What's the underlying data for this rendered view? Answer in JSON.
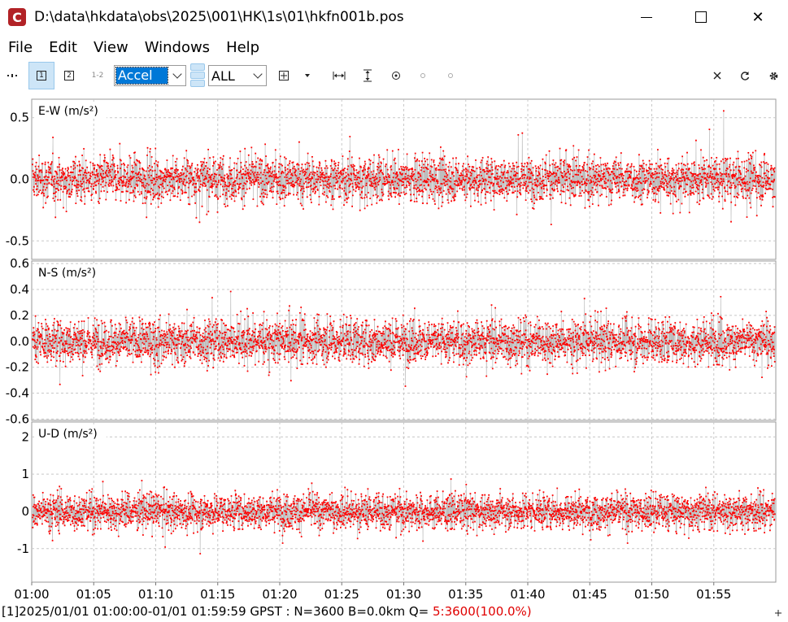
{
  "window": {
    "title": "D:\\data\\hkdata\\obs\\2025\\001\\HK\\1s\\01\\hkfn001b.pos",
    "minimize": "—",
    "maximize": "□",
    "close": "✕"
  },
  "menu": [
    "File",
    "Edit",
    "View",
    "Windows",
    "Help"
  ],
  "toolbar": {
    "btn1": "1",
    "btn2": "2",
    "btn12": "1-2",
    "plot_type": "Accel",
    "sat_filter": "ALL"
  },
  "statusbar": {
    "prefix": "[1]2025/01/01 01:00:00-01/01 01:59:59 GPST : N=3600 B=0.0km Q= ",
    "quality": "5:3600(100.0%)"
  },
  "colors": {
    "points": "#ff0000",
    "lines": "#bdbdbd",
    "grid": "#c8c8c8",
    "selected": "#0078d7"
  },
  "chart_data": [
    {
      "type": "scatter",
      "title": "E-W (m/s²)",
      "yticks": [
        {
          "value": 0.5,
          "label": "0.5"
        },
        {
          "value": 0.0,
          "label": "0.0"
        },
        {
          "value": -0.5,
          "label": "-0.5"
        }
      ],
      "ylim": [
        -0.65,
        0.65
      ],
      "noise_sigma": 0.17,
      "n_points": 3600
    },
    {
      "type": "scatter",
      "title": "N-S (m/s²)",
      "yticks": [
        {
          "value": 0.6,
          "label": "0.6"
        },
        {
          "value": 0.4,
          "label": "0.4"
        },
        {
          "value": 0.2,
          "label": "0.2"
        },
        {
          "value": 0.0,
          "label": "0.0"
        },
        {
          "value": -0.2,
          "label": "-0.2"
        },
        {
          "value": -0.4,
          "label": "-0.4"
        },
        {
          "value": -0.6,
          "label": "-0.6"
        }
      ],
      "ylim": [
        -0.61,
        0.62
      ],
      "noise_sigma": 0.16,
      "n_points": 3600
    },
    {
      "type": "scatter",
      "title": "U-D (m/s²)",
      "yticks": [
        {
          "value": 2,
          "label": "2"
        },
        {
          "value": 1,
          "label": "1"
        },
        {
          "value": 0,
          "label": "0"
        },
        {
          "value": -1,
          "label": "-1"
        }
      ],
      "ylim": [
        -1.9,
        2.4
      ],
      "noise_sigma": 0.45,
      "n_points": 3600
    }
  ],
  "x_axis": {
    "ticks": [
      "01:00",
      "01:05",
      "01:10",
      "01:15",
      "01:20",
      "01:25",
      "01:30",
      "01:35",
      "01:40",
      "01:45",
      "01:50",
      "01:55"
    ],
    "range_min": [
      0,
      60
    ]
  }
}
